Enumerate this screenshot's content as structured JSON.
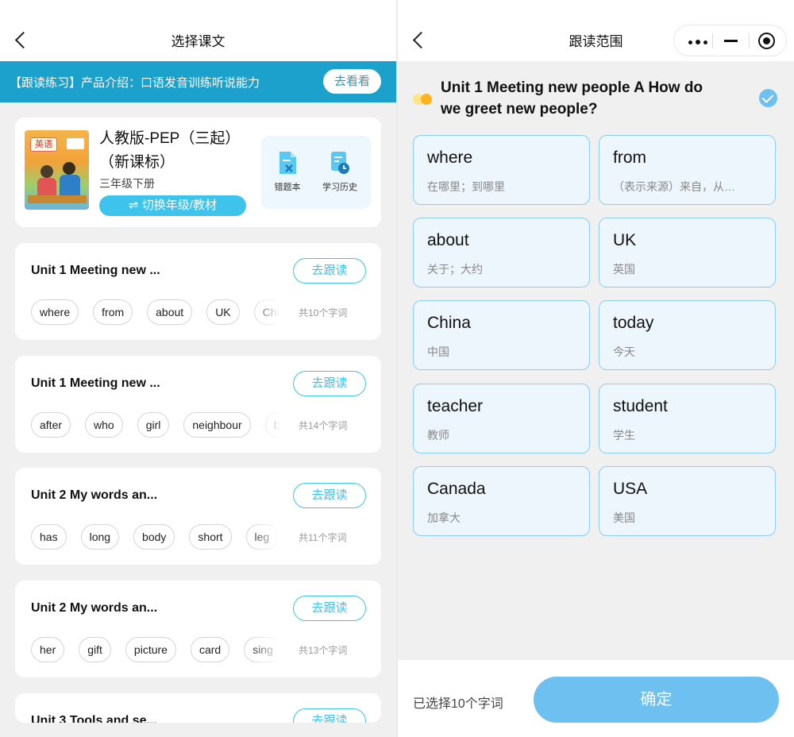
{
  "left": {
    "nav_title": "选择课文",
    "banner": {
      "text": "【跟读练习】产品介绍：口语发音训练听说能力",
      "button": "去看看"
    },
    "book": {
      "cover_label": "英语",
      "title": "人教版-PEP（三起）",
      "subtitle": "（新课标）",
      "grade": "三年级下册",
      "switch_label": "⇌ 切换年级/教材",
      "tools": [
        {
          "label": "错题本",
          "icon": "wrong-questions-icon"
        },
        {
          "label": "学习历史",
          "icon": "study-history-icon"
        }
      ]
    },
    "units": [
      {
        "title": "Unit 1 Meeting new ...",
        "button": "去跟读",
        "count": "共10个字词",
        "words": [
          "where",
          "from",
          "about",
          "UK",
          "China"
        ]
      },
      {
        "title": "Unit 1 Meeting new ...",
        "button": "去跟读",
        "count": "共14个字词",
        "words": [
          "after",
          "who",
          "girl",
          "neighbour",
          "boy"
        ]
      },
      {
        "title": "Unit 2 My words an...",
        "button": "去跟读",
        "count": "共11个字词",
        "words": [
          "has",
          "long",
          "body",
          "short",
          "leg"
        ]
      },
      {
        "title": "Unit 2 My words an...",
        "button": "去跟读",
        "count": "共13个字词",
        "words": [
          "her",
          "gift",
          "picture",
          "card",
          "sing"
        ]
      },
      {
        "title": "Unit 3 Tools and se...",
        "button": "去跟读",
        "count": "",
        "words": []
      }
    ]
  },
  "right": {
    "nav_title": "跟读范围",
    "section_title": "Unit 1 Meeting new people A How do we greet new people?",
    "words": [
      {
        "en": "where",
        "zh": "在哪里；到哪里"
      },
      {
        "en": "from",
        "zh": "（表示来源）来自，从…"
      },
      {
        "en": "about",
        "zh": "关于；大约"
      },
      {
        "en": "UK",
        "zh": "英国"
      },
      {
        "en": "China",
        "zh": "中国"
      },
      {
        "en": "today",
        "zh": "今天"
      },
      {
        "en": "teacher",
        "zh": "教师"
      },
      {
        "en": "student",
        "zh": "学生"
      },
      {
        "en": "Canada",
        "zh": "加拿大"
      },
      {
        "en": "USA",
        "zh": "美国"
      }
    ],
    "footer": {
      "selected_text": "已选择10个字词",
      "confirm": "确定"
    }
  },
  "colors": {
    "accent": "#3ec3ec",
    "banner": "#1ca0cc",
    "confirm": "#6ec0f0",
    "card_border": "#8fcdf0",
    "dot_a": "#ffe58a",
    "dot_b": "#ffb320"
  }
}
